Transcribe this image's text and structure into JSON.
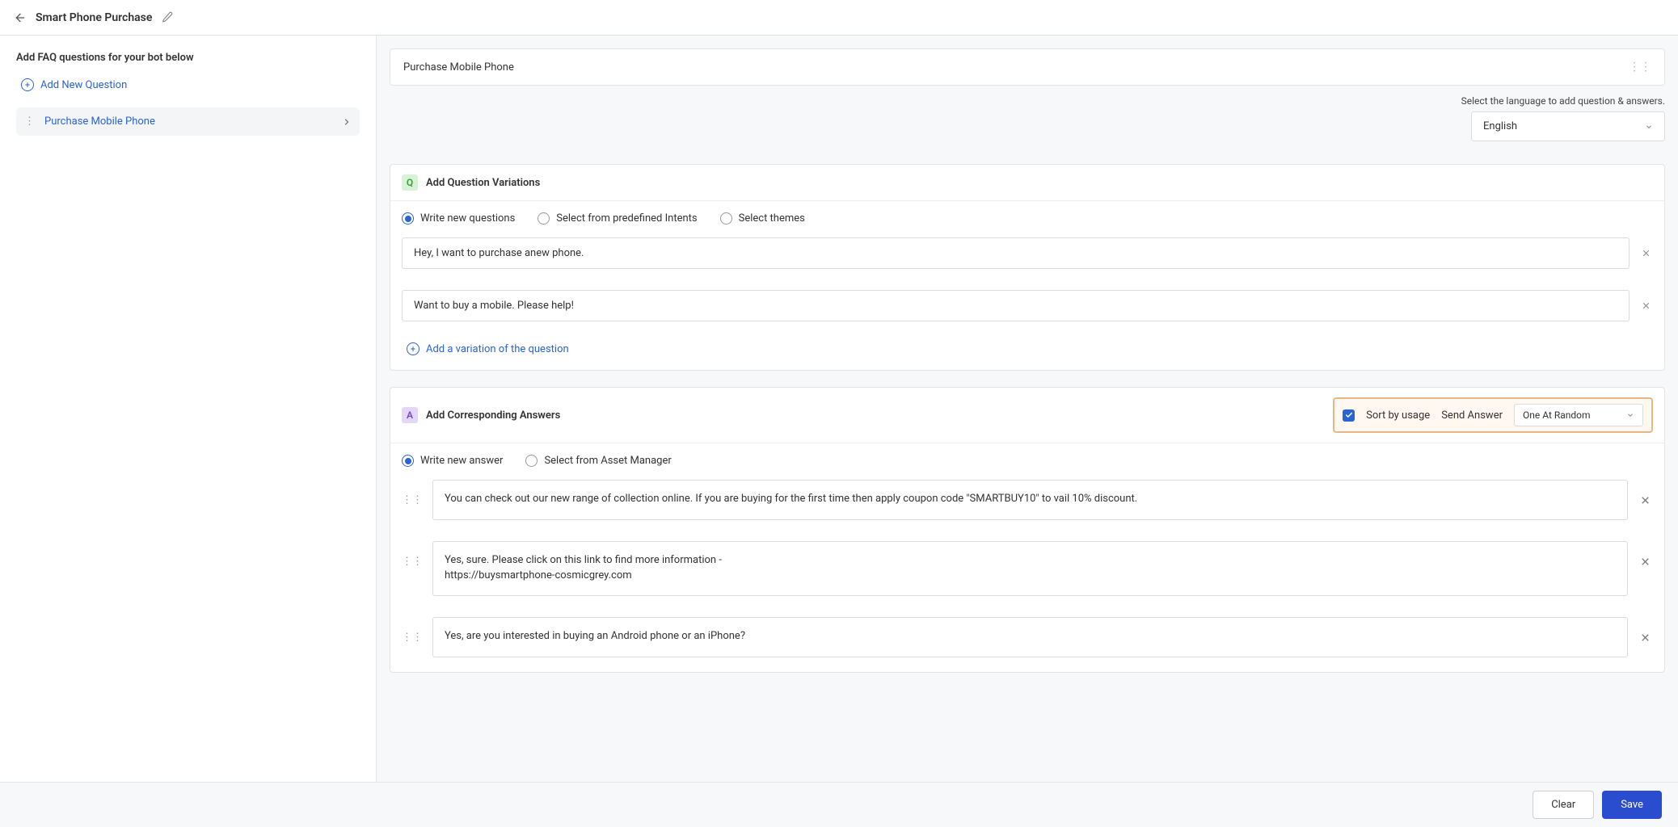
{
  "header": {
    "title": "Smart Phone Purchase"
  },
  "sidebar": {
    "heading": "Add FAQ questions for your bot below",
    "add_new_label": "Add New Question",
    "items": [
      {
        "label": "Purchase Mobile Phone"
      }
    ]
  },
  "main": {
    "question_title": "Purchase Mobile Phone",
    "language_label": "Select the language to add question & answers.",
    "language_value": "English"
  },
  "question_card": {
    "title": "Add Question Variations",
    "radios": [
      {
        "label": "Write new questions",
        "selected": true
      },
      {
        "label": "Select from predefined Intents",
        "selected": false
      },
      {
        "label": "Select themes",
        "selected": false
      }
    ],
    "variations": [
      "Hey, I want to purchase  anew phone.",
      "Want to buy a mobile. Please help!"
    ],
    "add_variation_label": "Add a variation of the question"
  },
  "answer_card": {
    "title": "Add Corresponding Answers",
    "sort_by_usage_label": "Sort by usage",
    "send_answer_label": "Send Answer",
    "send_answer_value": "One At Random",
    "radios": [
      {
        "label": "Write new answer",
        "selected": true
      },
      {
        "label": "Select from Asset Manager",
        "selected": false
      }
    ],
    "answers": [
      "You can check out our new range of collection online. If you are buying for the first time then apply coupon code \"SMARTBUY10\" to vail 10% discount.",
      "Yes, sure. Please click on this link to find more information -\nhttps://buysmartphone-cosmicgrey.com",
      "Yes, are you interested in buying an Android phone or an iPhone?"
    ]
  },
  "footer": {
    "clear_label": "Clear",
    "save_label": "Save"
  }
}
